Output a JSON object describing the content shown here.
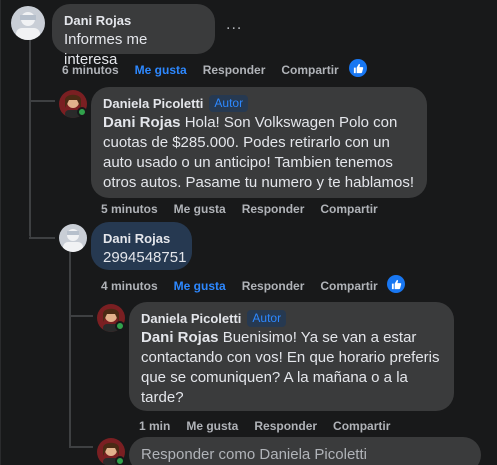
{
  "comments": [
    {
      "author": "Dani Rojas",
      "text": "Informes me interesa",
      "time": "6 minutos",
      "like_label": "Me gusta",
      "reply_label": "Responder",
      "share_label": "Compartir",
      "liked": true,
      "more_label": "..."
    },
    {
      "author": "Daniela Picoletti",
      "badge": "Autor",
      "mention": "Dani Rojas",
      "text": "Hola! Son Volkswagen Polo con cuotas de $285.000. Podes retirarlo con un auto usado o un anticipo! Tambien tenemos otros autos. Pasame tu numero y te hablamos!",
      "time": "5 minutos",
      "like_label": "Me gusta",
      "reply_label": "Responder",
      "share_label": "Compartir"
    },
    {
      "author": "Dani Rojas",
      "text": "2994548751",
      "time": "4 minutos",
      "like_label": "Me gusta",
      "reply_label": "Responder",
      "share_label": "Compartir",
      "liked": true
    },
    {
      "author": "Daniela Picoletti",
      "badge": "Autor",
      "mention": "Dani Rojas",
      "text": "Buenisimo! Ya se van a estar contactando con vos! En que horario preferis que se comuniquen? A la mañana o a la tarde?",
      "time": "1 min",
      "like_label": "Me gusta",
      "reply_label": "Responder",
      "share_label": "Compartir"
    }
  ],
  "reply_box": {
    "placeholder": "Responder como Daniela Picoletti"
  },
  "colors": {
    "background": "#18191a",
    "bubble": "#3a3b3c",
    "highlight_bubble": "#263951",
    "accent": "#2d88ff",
    "secondary_text": "#b0b3b8",
    "online": "#31a24c"
  },
  "icons": [
    "avatar-dani-rojas",
    "avatar-daniela-picoletti",
    "like-reaction-icon",
    "more-options-icon"
  ]
}
